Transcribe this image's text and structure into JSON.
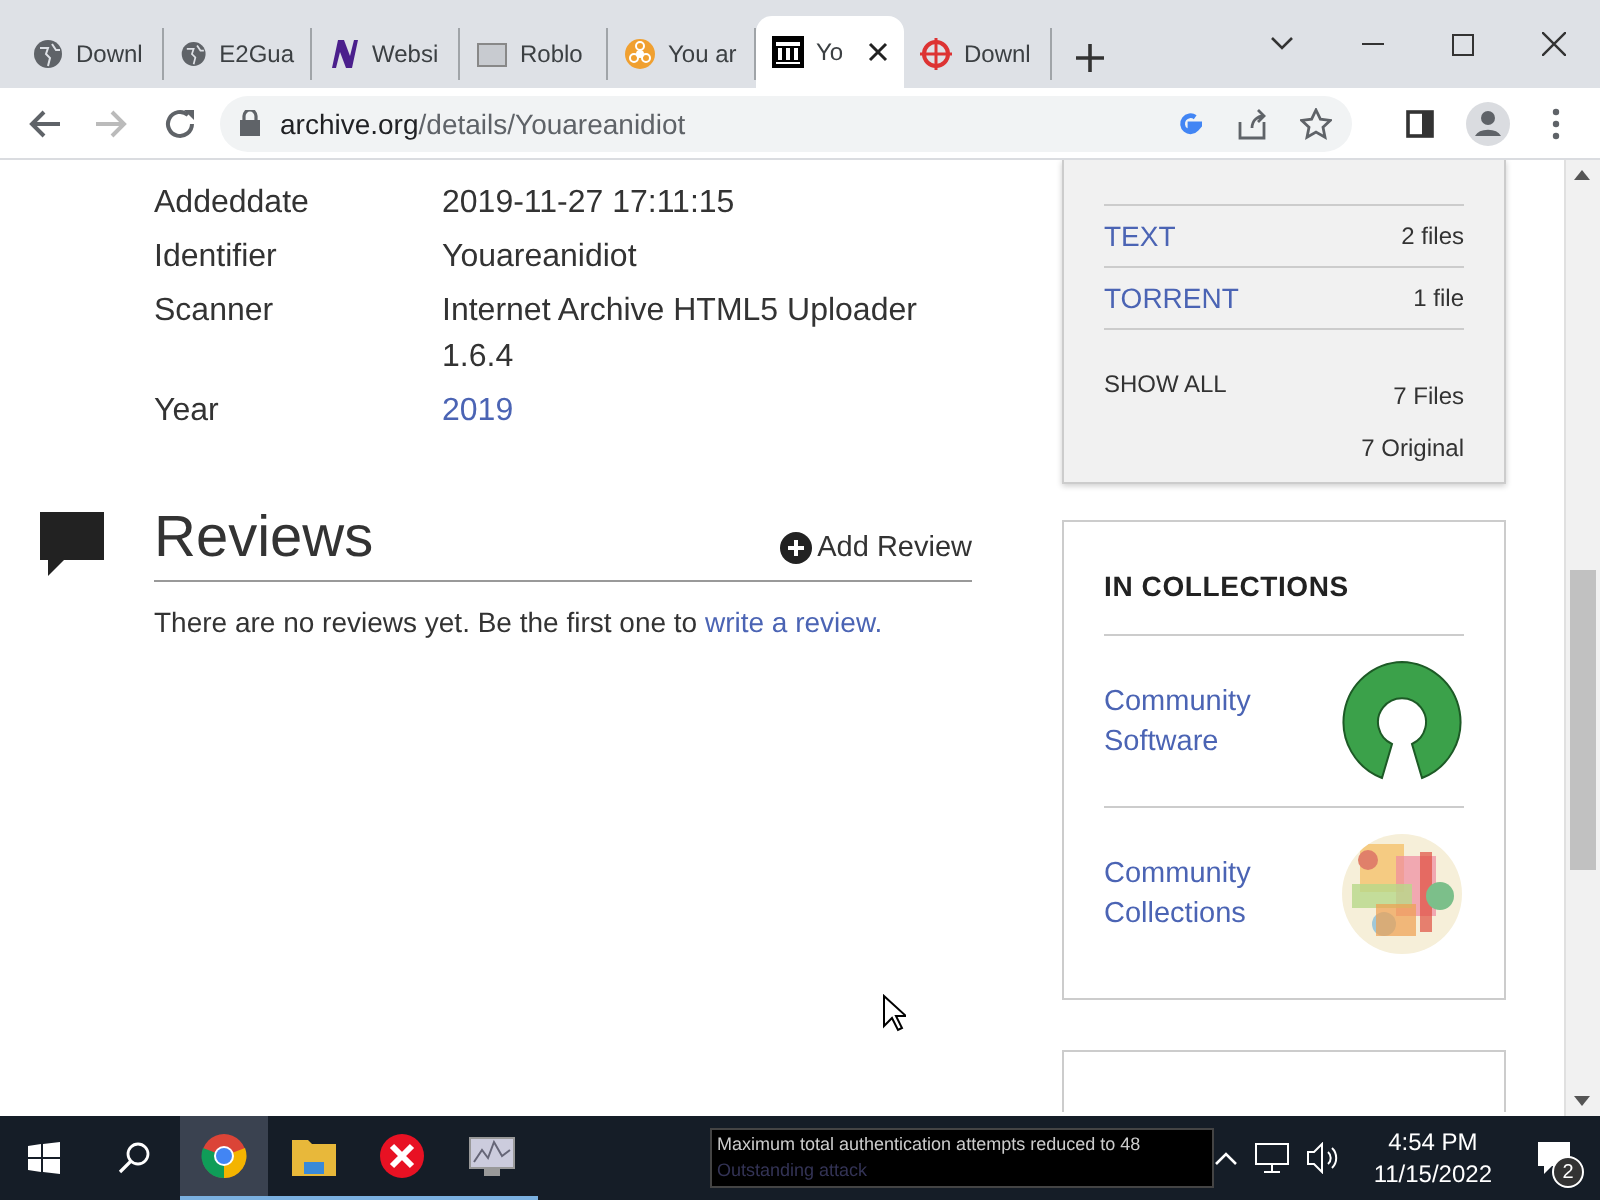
{
  "tabs": [
    {
      "title": "Downl",
      "kind": "globe",
      "selected": false
    },
    {
      "title": "E2Gua",
      "kind": "globe",
      "selected": false
    },
    {
      "title": "Websi",
      "kind": "letter",
      "selected": false
    },
    {
      "title": "Roblo",
      "kind": "image",
      "selected": false
    },
    {
      "title": "You ar",
      "kind": "hazard",
      "selected": false
    },
    {
      "title": "Yo",
      "kind": "temple",
      "selected": true
    },
    {
      "title": "Downl",
      "kind": "target",
      "selected": false
    }
  ],
  "address_bar": {
    "url_host": "archive.org",
    "url_path": "/details/Youareanidiot"
  },
  "metadata": [
    {
      "key": "Addeddate",
      "values": [
        "2019-11-27 17:11:15"
      ],
      "link": false
    },
    {
      "key": "Identifier",
      "values": [
        "Youareanidiot"
      ],
      "link": false
    },
    {
      "key": "Scanner",
      "values": [
        "Internet Archive HTML5 Uploader",
        "1.6.4"
      ],
      "link": false
    },
    {
      "key": "Year",
      "values": [
        "2019"
      ],
      "link": true
    }
  ],
  "reviews": {
    "heading": "Reviews",
    "add_button": "Add Review",
    "empty_text": "There are no reviews yet. Be the first one to ",
    "empty_link": "write a review."
  },
  "downloads": {
    "items": [
      {
        "format": "TEXT",
        "count": "2 files"
      },
      {
        "format": "TORRENT",
        "count": "1 file"
      }
    ],
    "show_all": "SHOW ALL",
    "totals": [
      "7 Files",
      "7 Original"
    ]
  },
  "collections": {
    "heading": "IN COLLECTIONS",
    "items": [
      {
        "name": "Community Software",
        "kind": "keyhole"
      },
      {
        "name": "Community Collections",
        "kind": "mosaic"
      }
    ]
  },
  "taskbar": {
    "apps": [
      {
        "kind": "chrome",
        "selected": true
      },
      {
        "kind": "folder",
        "selected": false
      },
      {
        "kind": "error",
        "selected": false
      },
      {
        "kind": "monitor",
        "selected": false
      }
    ],
    "notice": [
      "Maximum total authentication attempts reduced to 48",
      "Outstanding attack"
    ],
    "time": "4:54 PM",
    "date": "11/15/2022",
    "notifications": "2"
  }
}
